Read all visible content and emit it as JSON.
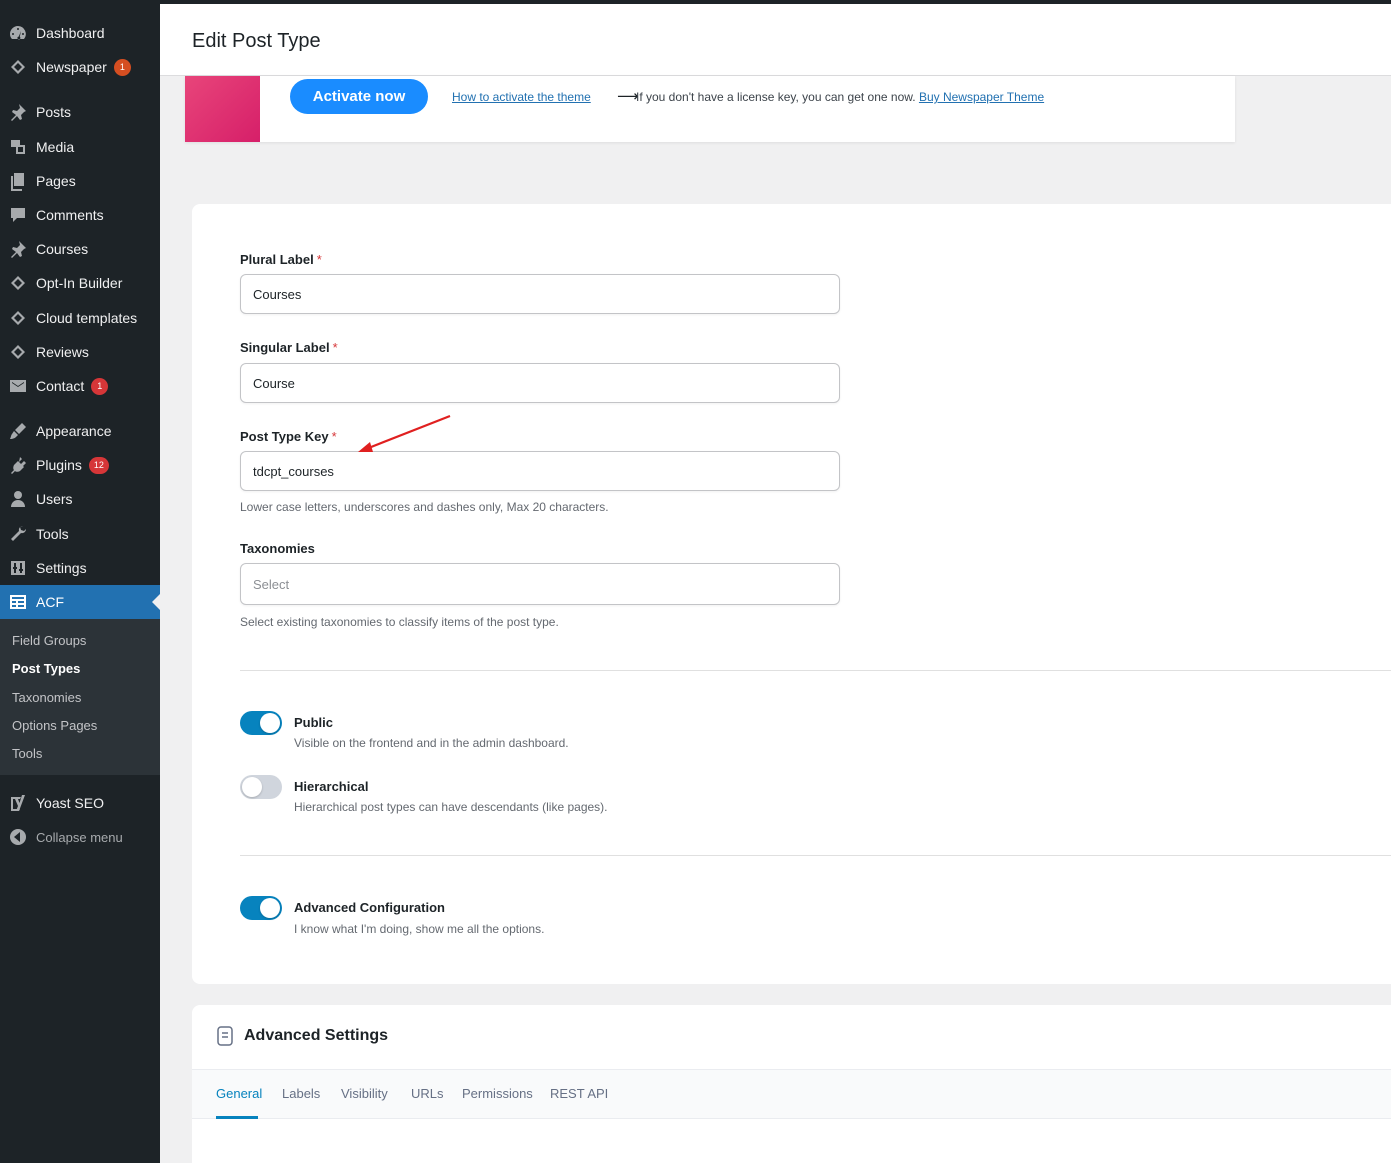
{
  "sidebar": {
    "items": [
      {
        "key": "dashboard",
        "label": "Dashboard",
        "icon": "dashboard-icon"
      },
      {
        "key": "newspaper",
        "label": "Newspaper",
        "icon": "newspaper-icon",
        "badge": "1"
      },
      {
        "key": "posts",
        "label": "Posts",
        "icon": "pushpin-icon"
      },
      {
        "key": "media",
        "label": "Media",
        "icon": "media-icon"
      },
      {
        "key": "pages",
        "label": "Pages",
        "icon": "pages-icon"
      },
      {
        "key": "comments",
        "label": "Comments",
        "icon": "comment-icon"
      },
      {
        "key": "courses",
        "label": "Courses",
        "icon": "pushpin-icon"
      },
      {
        "key": "optin",
        "label": "Opt-In Builder",
        "icon": "diamond-icon"
      },
      {
        "key": "cloud",
        "label": "Cloud templates",
        "icon": "diamond-icon"
      },
      {
        "key": "reviews",
        "label": "Reviews",
        "icon": "diamond-icon"
      },
      {
        "key": "contact",
        "label": "Contact",
        "icon": "mail-icon",
        "badge": "1"
      },
      {
        "key": "appearance",
        "label": "Appearance",
        "icon": "brush-icon"
      },
      {
        "key": "plugins",
        "label": "Plugins",
        "icon": "plugin-icon",
        "badge": "12"
      },
      {
        "key": "users",
        "label": "Users",
        "icon": "user-icon"
      },
      {
        "key": "tools",
        "label": "Tools",
        "icon": "wrench-icon"
      },
      {
        "key": "settings",
        "label": "Settings",
        "icon": "settings-icon"
      },
      {
        "key": "acf",
        "label": "ACF",
        "icon": "acf-icon"
      }
    ],
    "submenu": [
      "Field Groups",
      "Post Types",
      "Taxonomies",
      "Options Pages",
      "Tools"
    ],
    "yoast": "Yoast SEO",
    "collapse": "Collapse menu"
  },
  "header": {
    "title": "Edit Post Type"
  },
  "license": {
    "activate_label": "Activate now",
    "how_link": "How to activate the theme",
    "arrow": "⟶",
    "no_license_text": "If you don't have a license key, you can get one now.",
    "buy_link": "Buy Newspaper Theme"
  },
  "form": {
    "plural": {
      "label": "Plural Label",
      "required": "*",
      "value": "Courses"
    },
    "singular": {
      "label": "Singular Label",
      "required": "*",
      "value": "Course"
    },
    "key": {
      "label": "Post Type Key",
      "required": "*",
      "value": "tdcpt_courses",
      "help": "Lower case letters, underscores and dashes only, Max 20 characters."
    },
    "taxonomies": {
      "label": "Taxonomies",
      "placeholder": "Select",
      "help": "Select existing taxonomies to classify items of the post type."
    },
    "public": {
      "title": "Public",
      "desc": "Visible on the frontend and in the admin dashboard.",
      "on": true
    },
    "hierarchical": {
      "title": "Hierarchical",
      "desc": "Hierarchical post types can have descendants (like pages).",
      "on": false
    },
    "advanced": {
      "title": "Advanced Configuration",
      "desc": "I know what I'm doing, show me all the options.",
      "on": true
    }
  },
  "advanced_settings": {
    "title": "Advanced Settings",
    "tabs": [
      "General",
      "Labels",
      "Visibility",
      "URLs",
      "Permissions",
      "REST API"
    ],
    "active_tab": "General"
  },
  "colors": {
    "sidebar": "#1d2327",
    "accent": "#2271b1",
    "toggle_on": "#0783be",
    "annotation": "#e02020"
  }
}
